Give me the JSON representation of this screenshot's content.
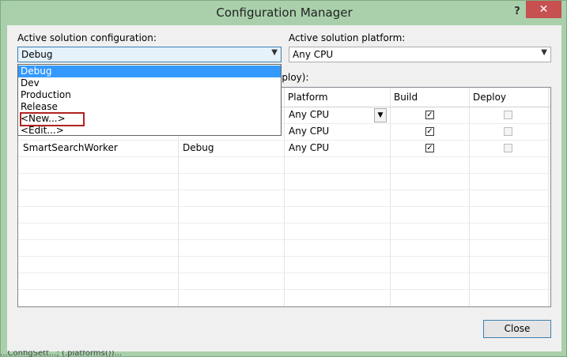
{
  "window": {
    "title": "Configuration Manager",
    "help": "?",
    "close": "✕"
  },
  "config_label": "Active solution configuration:",
  "platform_label": "Active solution platform:",
  "config_value": "Debug",
  "platform_value": "Any CPU",
  "projects_label_partial": "eploy):",
  "grid": {
    "headers": [
      "Platform",
      "Build",
      "Deploy"
    ],
    "rows": [
      {
        "project": "",
        "configuration": "",
        "platform": "Any CPU",
        "build": true,
        "deploy": false
      },
      {
        "project": "",
        "configuration": "",
        "platform": "Any CPU",
        "build": true,
        "deploy": false
      },
      {
        "project": "SmartSearchWorker",
        "configuration": "Debug",
        "platform": "Any CPU",
        "build": true,
        "deploy": false
      }
    ]
  },
  "dropdown_items": [
    "Debug",
    "Dev",
    "Production",
    "Release",
    "<New...>",
    "<Edit...>"
  ],
  "close_button": "Close",
  "underlying_text": "...ConfigSett...; (.platforms())..."
}
